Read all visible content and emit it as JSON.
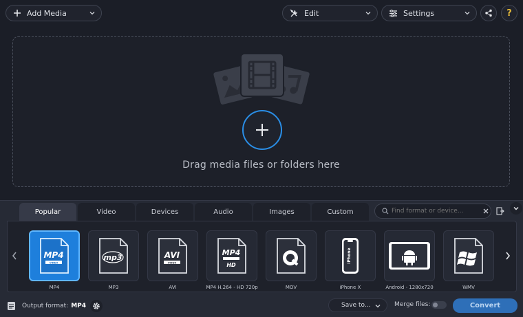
{
  "toolbar": {
    "add_media": "Add Media",
    "edit": "Edit",
    "settings": "Settings",
    "help": "?"
  },
  "dropzone": {
    "text": "Drag media files or folders here"
  },
  "tabs": [
    "Popular",
    "Video",
    "Devices",
    "Audio",
    "Images",
    "Custom"
  ],
  "active_tab": "Popular",
  "search": {
    "placeholder": "Find format or device..."
  },
  "formats": [
    {
      "label": "MP4",
      "icon": "mp4-icon",
      "badge": "MP4",
      "sub": "VIDEO"
    },
    {
      "label": "MP3",
      "icon": "mp3-icon",
      "badge": "mp3",
      "sub": ""
    },
    {
      "label": "AVI",
      "icon": "avi-icon",
      "badge": "AVI",
      "sub": "VIDEO"
    },
    {
      "label": "MP4 H.264 - HD 720p",
      "icon": "mp4-hd-icon",
      "badge": "MP4",
      "sub": "HD"
    },
    {
      "label": "MOV",
      "icon": "quicktime-icon",
      "badge": "",
      "sub": ""
    },
    {
      "label": "iPhone X",
      "icon": "iphone-icon",
      "badge": "iPhone",
      "sub": ""
    },
    {
      "label": "Android - 1280x720",
      "icon": "android-tablet-icon",
      "badge": "",
      "sub": ""
    },
    {
      "label": "WMV",
      "icon": "windows-icon",
      "badge": "",
      "sub": ""
    }
  ],
  "footer": {
    "output_label": "Output format:",
    "output_value": "MP4",
    "save_to": "Save to...",
    "merge_label": "Merge files:",
    "convert": "Convert"
  },
  "colors": {
    "accent": "#1e7fdc",
    "background": "#1b1e27",
    "panel": "#262a35"
  }
}
